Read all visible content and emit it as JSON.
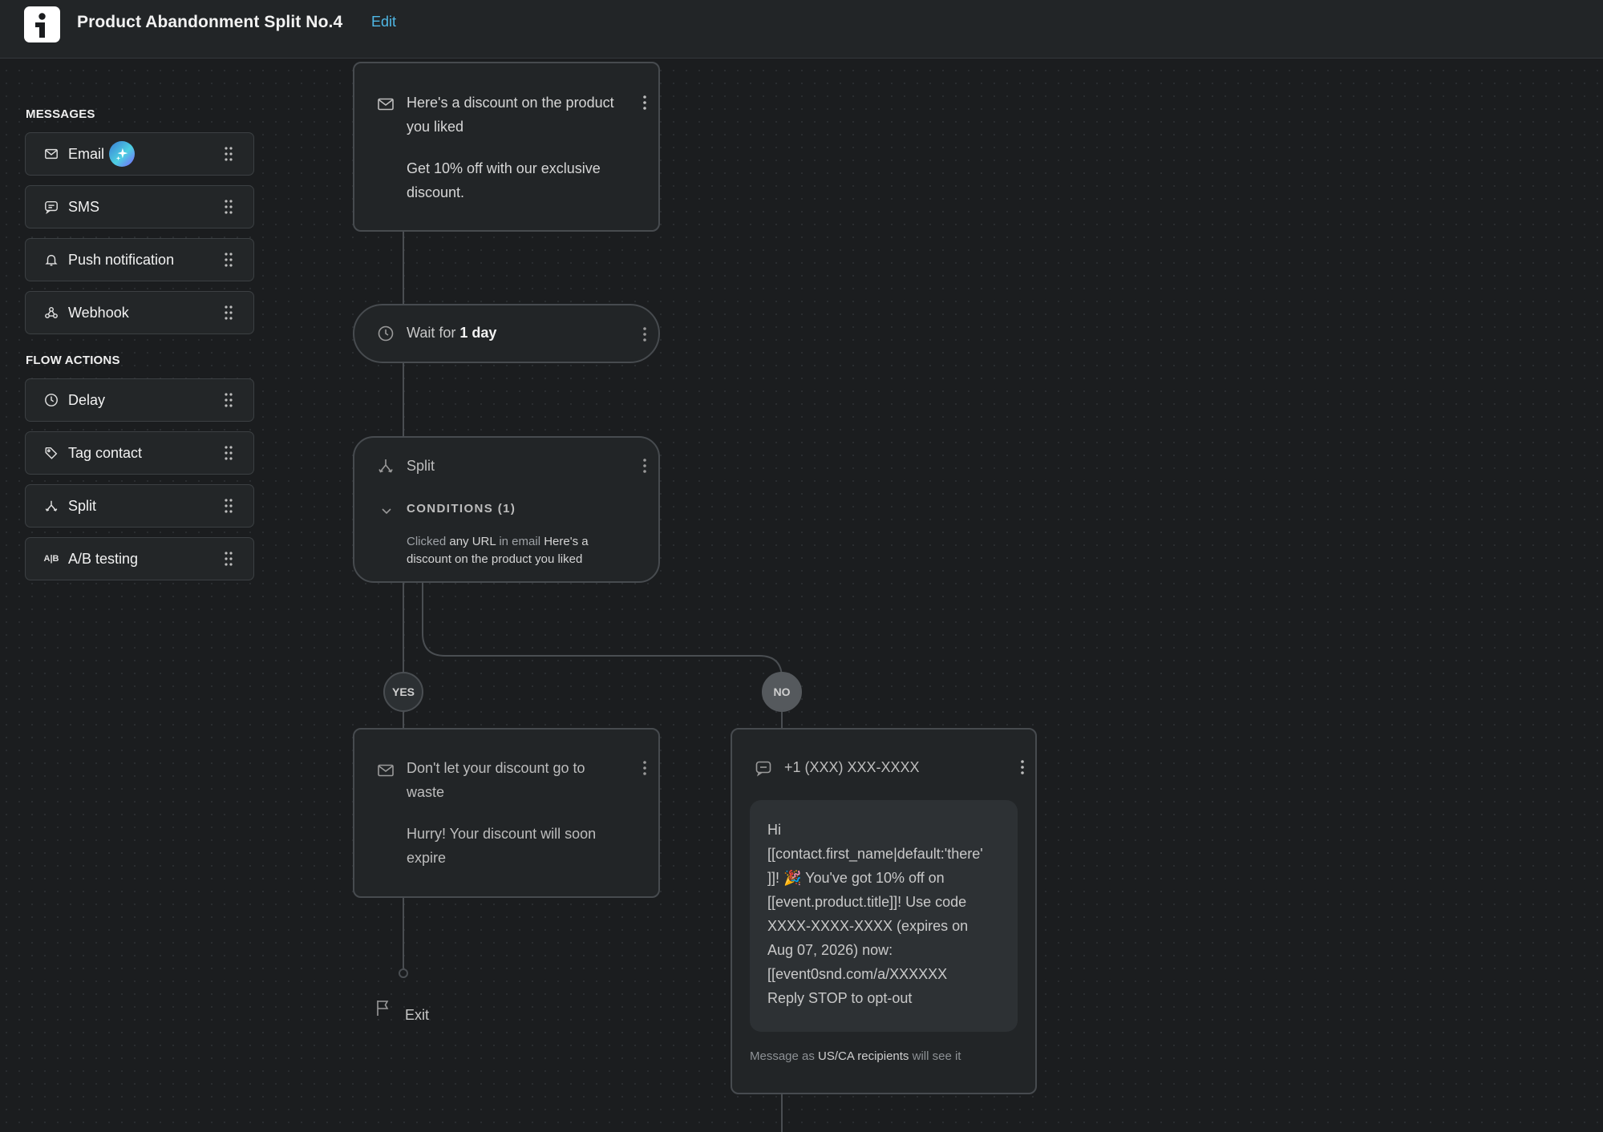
{
  "header": {
    "title": "Product Abandonment Split No.4",
    "edit_label": "Edit"
  },
  "sidebar": {
    "messages_heading": "MESSAGES",
    "messages": [
      {
        "label": "Email",
        "icon": "mail-icon",
        "ai": true
      },
      {
        "label": "SMS",
        "icon": "chat-icon"
      },
      {
        "label": "Push notification",
        "icon": "bell-icon"
      },
      {
        "label": "Webhook",
        "icon": "webhook-icon"
      }
    ],
    "actions_heading": "FLOW ACTIONS",
    "actions": [
      {
        "label": "Delay",
        "icon": "clock-icon"
      },
      {
        "label": "Tag contact",
        "icon": "tag-icon"
      },
      {
        "label": "Split",
        "icon": "split-icon"
      },
      {
        "label": "A/B testing",
        "icon": "ab-icon",
        "icon_text": "A|B"
      }
    ]
  },
  "flow": {
    "email1": {
      "title_line1": "Here's a discount on the product",
      "title_line2": "you liked",
      "body_line1": "Get 10% off with our exclusive",
      "body_line2": "discount."
    },
    "wait": {
      "prefix": "Wait for",
      "duration": "1 day"
    },
    "split": {
      "title": "Split",
      "conditions_label": "CONDITIONS (1)",
      "cond_p1": "Clicked",
      "cond_p2": "any",
      "cond_p3": "URL",
      "cond_p4": "in email",
      "cond_p5": "Here's a",
      "cond_p6": "discount on the product you liked"
    },
    "branch_yes": "YES",
    "branch_no": "NO",
    "email2": {
      "title_line1": "Don't let your discount go to",
      "title_line2": "waste",
      "body_line1": "Hurry! Your discount will soon",
      "body_line2": "expire"
    },
    "sms": {
      "phone": "+1 (XXX) XXX-XXXX",
      "lines": [
        "Hi",
        "[[contact.first_name|default:'there'",
        "]]! 🎉 You've got 10% off on",
        "[[event.product.title]]! Use code",
        "XXXX-XXXX-XXXX (expires on",
        "Aug 07, 2026) now:",
        "[[event0snd.com/a/XXXXXX",
        "Reply STOP to opt-out"
      ],
      "footer_prefix": "Message as",
      "footer_recipients": "US/CA recipients",
      "footer_suffix": "will see it"
    },
    "exit_label": "Exit"
  }
}
